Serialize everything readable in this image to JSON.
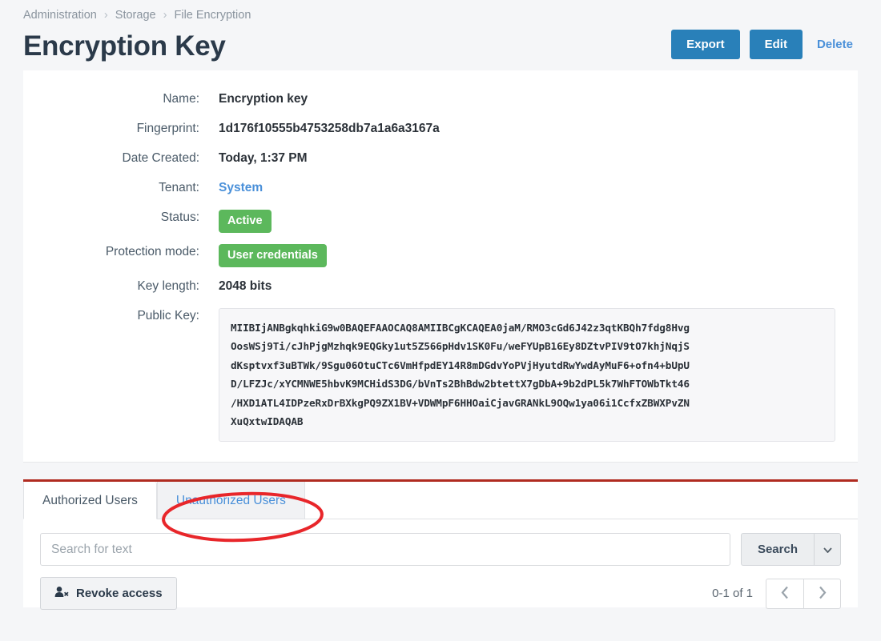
{
  "breadcrumb": {
    "items": [
      "Administration",
      "Storage",
      "File Encryption"
    ],
    "separator": "›"
  },
  "header": {
    "title": "Encryption Key",
    "actions": {
      "export_label": "Export",
      "edit_label": "Edit",
      "delete_label": "Delete"
    }
  },
  "details": {
    "rows": [
      {
        "label": "Name:",
        "value": "Encryption key",
        "kind": "text"
      },
      {
        "label": "Fingerprint:",
        "value": "1d176f10555b4753258db7a1a6a3167a",
        "kind": "text"
      },
      {
        "label": "Date Created:",
        "value": "Today, 1:37 PM",
        "kind": "text"
      },
      {
        "label": "Tenant:",
        "value": "System",
        "kind": "link"
      },
      {
        "label": "Status:",
        "value": "Active",
        "kind": "badge"
      },
      {
        "label": "Protection mode:",
        "value": "User credentials",
        "kind": "badge"
      },
      {
        "label": "Key length:",
        "value": "2048 bits",
        "kind": "text"
      }
    ],
    "public_key_label": "Public Key:",
    "public_key_lines": [
      "MIIBIjANBgkqhkiG9w0BAQEFAAOCAQ8AMIIBCgKCAQEA0jaM/RMO3cGd6J42z3qtKBQh7fdg8Hvg",
      "OosWSj9Ti/cJhPjgMzhqk9EQGky1ut5Z566pHdv1SK0Fu/weFYUpB16Ey8DZtvPIV9tO7khjNqjS",
      "dKsptvxf3uBTWk/9Sgu06OtuCTc6VmHfpdEY14R8mDGdvYoPVjHyutdRwYwdAyMuF6+ofn4+bUpU",
      "D/LFZJc/xYCMNWE5hbvK9MCHidS3DG/bVnTs2BhBdw2btettX7gDbA+9b2dPL5k7WhFTOWbTkt46",
      "/HXD1ATL4IDPzeRxDrBXkgPQ9ZX1BV+VDWMpF6HHOaiCjavGRANkL9OQw1ya06i1CcfxZBWXPvZN",
      "XuQxtwIDAQAB"
    ]
  },
  "tabs": {
    "authorized_label": "Authorized Users",
    "unauthorized_label": "Unauthorized Users",
    "active": "Authorized Users"
  },
  "search": {
    "value": "",
    "placeholder": "Search for text",
    "button_label": "Search",
    "caret_icon": "chevron-down-icon"
  },
  "toolbar": {
    "revoke_label": "Revoke access",
    "revoke_icon": "user-times-icon"
  },
  "pagination": {
    "count_label": "0-1 of 1",
    "prev_icon": "chevron-left-icon",
    "next_icon": "chevron-right-icon"
  },
  "annotation": {
    "shape": "ellipse-highlight",
    "color": "#e8262a",
    "targets": "Unauthorized Users"
  },
  "colors": {
    "primary_button": "#2980b9",
    "link": "#4a90d9",
    "badge_green": "#5cb85c",
    "panel_accent": "#b02b20",
    "page_background": "#f5f6f8",
    "annotation_red": "#e8262a"
  }
}
